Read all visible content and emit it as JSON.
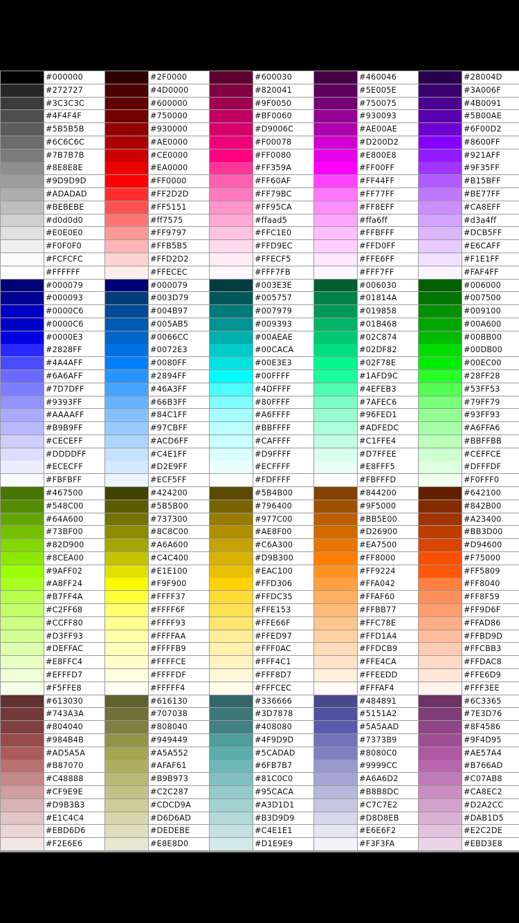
{
  "color_table": {
    "columns": [
      [
        "#000000",
        "#272727",
        "#3C3C3C",
        "#4F4F4F",
        "#5B5B5B",
        "#6C6C6C",
        "#7B7B7B",
        "#8E8E8E",
        "#9D9D9D",
        "#ADADAD",
        "#BEBEBE",
        "#d0d0d0",
        "#E0E0E0",
        "#F0F0F0",
        "#FCFCFC",
        "#FFFFFF",
        "#000079",
        "#000093",
        "#0000C6",
        "#0000C6",
        "#0000E3",
        "#2828FF",
        "#4A4AFF",
        "#6A6AFF",
        "#7D7DFF",
        "#9393FF",
        "#AAAAFF",
        "#B9B9FF",
        "#CECEFF",
        "#DDDDFF",
        "#ECECFF",
        "#FBFBFF",
        "#467500",
        "#548C00",
        "#64A600",
        "#73BF00",
        "#82D900",
        "#8CEA00",
        "#9AFF02",
        "#A8FF24",
        "#B7FF4A",
        "#C2FF68",
        "#CCFF80",
        "#D3FF93",
        "#DEFFAC",
        "#E8FFC4",
        "#EFFFD7",
        "#F5FFE8",
        "#613030",
        "#743A3A",
        "#804040",
        "#984B4B",
        "#AD5A5A",
        "#B87070",
        "#C48888",
        "#CF9E9E",
        "#D9B3B3",
        "#E1C4C4",
        "#EBD6D6",
        "#F2E6E6"
      ],
      [
        "#2F0000",
        "#4D0000",
        "#600000",
        "#750000",
        "#930000",
        "#AE0000",
        "#CE0000",
        "#EA0000",
        "#FF0000",
        "#FF2D2D",
        "#FF5151",
        "#ff7575",
        "#FF9797",
        "#FFB5B5",
        "#FFD2D2",
        "#FFECEC",
        "#000079",
        "#003D79",
        "#004B97",
        "#005AB5",
        "#0066CC",
        "#0072E3",
        "#0080FF",
        "#2894FF",
        "#46A3FF",
        "#66B3FF",
        "#84C1FF",
        "#97CBFF",
        "#ACD6FF",
        "#C4E1FF",
        "#D2E9FF",
        "#ECF5FF",
        "#424200",
        "#5B5B00",
        "#737300",
        "#8C8C00",
        "#A6A600",
        "#C4C400",
        "#E1E100",
        "#F9F900",
        "#FFFF37",
        "#FFFF6F",
        "#FFFF93",
        "#FFFFAA",
        "#FFFFB9",
        "#FFFFCE",
        "#FFFFDF",
        "#FFFFF4",
        "#616130",
        "#707038",
        "#808040",
        "#949449",
        "#A5A552",
        "#AFAF61",
        "#B9B973",
        "#C2C287",
        "#CDCD9A",
        "#D6D6AD",
        "#DEDEBE",
        "#E8E8D0"
      ],
      [
        "#600030",
        "#820041",
        "#9F0050",
        "#BF0060",
        "#D9006C",
        "#F00078",
        "#FF0080",
        "#FF359A",
        "#FF60AF",
        "#FF79BC",
        "#FF95CA",
        "#ffaad5",
        "#FFC1E0",
        "#FFD9EC",
        "#FFECF5",
        "#FFF7FB",
        "#003E3E",
        "#005757",
        "#007979",
        "#009393",
        "#00AEAE",
        "#00CACA",
        "#00E3E3",
        "#00FFFF",
        "#4DFFFF",
        "#80FFFF",
        "#A6FFFF",
        "#BBFFFF",
        "#CAFFFF",
        "#D9FFFF",
        "#ECFFFF",
        "#FDFFFF",
        "#5B4B00",
        "#796400",
        "#977C00",
        "#AE8F00",
        "#C6A300",
        "#D9B300",
        "#EAC100",
        "#FFD306",
        "#FFDC35",
        "#FFE153",
        "#FFE66F",
        "#FFED97",
        "#FFF0AC",
        "#FFF4C1",
        "#FFF8D7",
        "#FFFCEC",
        "#336666",
        "#3D7878",
        "#408080",
        "#4F9D9D",
        "#5CADAD",
        "#6FB7B7",
        "#81C0C0",
        "#95CACA",
        "#A3D1D1",
        "#B3D9D9",
        "#C4E1E1",
        "#D1E9E9"
      ],
      [
        "#460046",
        "#5E005E",
        "#750075",
        "#930093",
        "#AE00AE",
        "#D200D2",
        "#E800E8",
        "#FF00FF",
        "#FF44FF",
        "#FF77FF",
        "#FF8EFF",
        "#ffa6ff",
        "#FFBFFF",
        "#FFD0FF",
        "#FFE6FF",
        "#FFF7FF",
        "#006030",
        "#01814A",
        "#019858",
        "#01B468",
        "#02C874",
        "#02DF82",
        "#02F78E",
        "#1AFD9C",
        "#4EFEB3",
        "#7AFEC6",
        "#96FED1",
        "#ADFEDC",
        "#C1FFE4",
        "#D7FFEE",
        "#E8FFF5",
        "#FBFFFD",
        "#844200",
        "#9F5000",
        "#BB5E00",
        "#D26900",
        "#EA7500",
        "#FF8000",
        "#FF9224",
        "#FFA042",
        "#FFAF60",
        "#FFBB77",
        "#FFC78E",
        "#FFD1A4",
        "#FFDCB9",
        "#FFE4CA",
        "#FFEEDD",
        "#FFFAF4",
        "#484891",
        "#5151A2",
        "#5A5AAD",
        "#7373B9",
        "#8080C0",
        "#9999CC",
        "#A6A6D2",
        "#B8B8DC",
        "#C7C7E2",
        "#D8D8EB",
        "#E6E6F2",
        "#F3F3FA"
      ],
      [
        "#28004D",
        "#3A006F",
        "#4B0091",
        "#5B00AE",
        "#6F00D2",
        "#8600FF",
        "#921AFF",
        "#9F35FF",
        "#B15BFF",
        "#BE77FF",
        "#CA8EFF",
        "#d3a4ff",
        "#DCB5FF",
        "#E6CAFF",
        "#F1E1FF",
        "#FAF4FF",
        "#006000",
        "#007500",
        "#009100",
        "#00A600",
        "#00BB00",
        "#00DB00",
        "#00EC00",
        "#28FF28",
        "#53FF53",
        "#79FF79",
        "#93FF93",
        "#A6FFA6",
        "#BBFFBB",
        "#CEFFCE",
        "#DFFFDF",
        "#F0FFF0",
        "#642100",
        "#842B00",
        "#A23400",
        "#BB3D00",
        "#D94600",
        "#F75000",
        "#FF5809",
        "#FF8040",
        "#FF8F59",
        "#FF9D6F",
        "#FFAD86",
        "#FFBD9D",
        "#FFCBB3",
        "#FFDAC8",
        "#FFE6D9",
        "#FFF3EE",
        "#6C3365",
        "#7E3D76",
        "#8F4586",
        "#9F4D95",
        "#AE57A4",
        "#B766AD",
        "#C07AB8",
        "#CA8EC2",
        "#D2A2CC",
        "#DAB1D5",
        "#E2C2DE",
        "#EBD3E8"
      ]
    ]
  }
}
